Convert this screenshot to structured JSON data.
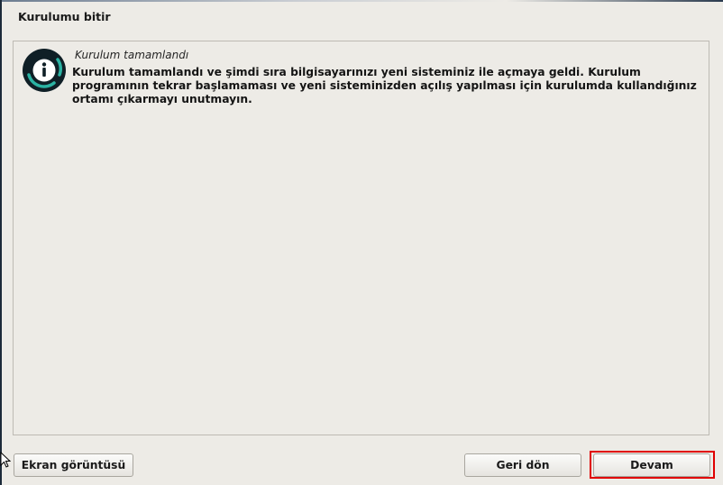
{
  "window": {
    "title": "Kurulumu bitir"
  },
  "message": {
    "icon": "info-icon",
    "title": "Kurulum tamamlandı",
    "body_lines": [
      "Kurulum tamamlandı ve şimdi sıra bilgisayarınızı yeni sisteminiz ile açmaya geldi. Kurulum",
      "programının tekrar başlamaması ve yeni sisteminizden açılış yapılması için kurulumda kullandığınız",
      "ortamı çıkarmayı unutmayın."
    ]
  },
  "buttons": {
    "screenshot_label": "Ekran görüntüsü",
    "back_label": "Geri dön",
    "continue_label": "Devam"
  },
  "colors": {
    "background": "#edebe6",
    "highlight": "#e00000",
    "icon_dark": "#0f1f26",
    "icon_ring": "#2bb3a3"
  }
}
